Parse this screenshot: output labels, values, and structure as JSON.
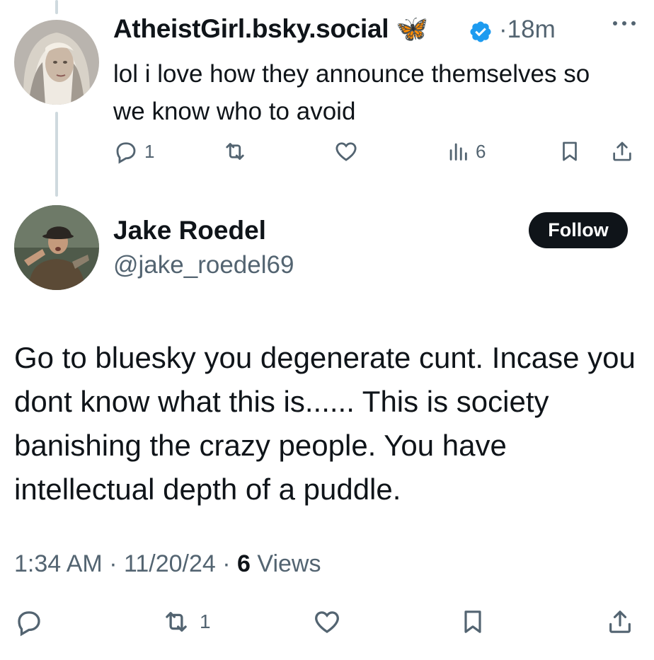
{
  "reply_tweet": {
    "display_name": "AtheistGirl.bsky.social",
    "emoji": "🦋",
    "separator": "·",
    "time": "18m",
    "text": "lol i love how they announce themselves so we know who to avoid",
    "actions": {
      "reply_count": "1",
      "retweet_count": "",
      "like_count": "",
      "views_count": "6"
    }
  },
  "main_tweet": {
    "display_name": "Jake Roedel",
    "handle": "@jake_roedel69",
    "follow_label": "Follow",
    "text": "Go to bluesky you degenerate cunt. Incase you dont know what this is...... This is society banishing the crazy people. You have intellectual depth of a puddle.",
    "time": "1:34 AM",
    "sep1": " · ",
    "date": "11/20/24",
    "sep2": " · ",
    "views_count": "6",
    "views_label": " Views",
    "actions": {
      "reply_count": "",
      "retweet_count": "1",
      "like_count": ""
    }
  },
  "colors": {
    "text": "#0f1419",
    "secondary": "#536471",
    "verified": "#1d9bf0",
    "follow_bg": "#0f1419"
  }
}
